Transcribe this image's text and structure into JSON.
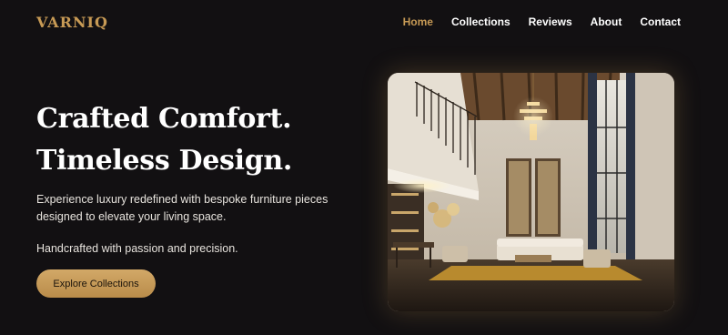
{
  "brand": {
    "name": "VARNIQ"
  },
  "nav": {
    "items": [
      {
        "label": "Home",
        "active": true
      },
      {
        "label": "Collections",
        "active": false
      },
      {
        "label": "Reviews",
        "active": false
      },
      {
        "label": "About",
        "active": false
      },
      {
        "label": "Contact",
        "active": false
      }
    ]
  },
  "hero": {
    "title_line1": "Crafted Comfort.",
    "title_line2": "Timeless Design.",
    "description": "Experience luxury redefined with bespoke furniture pieces designed to elevate your living space.",
    "note": "Handcrafted with passion and precision.",
    "cta_label": "Explore Collections",
    "image_subject": "luxury-living-room-interior"
  },
  "colors": {
    "background": "#121012",
    "accent": "#c79a55",
    "text": "#ffffff"
  }
}
